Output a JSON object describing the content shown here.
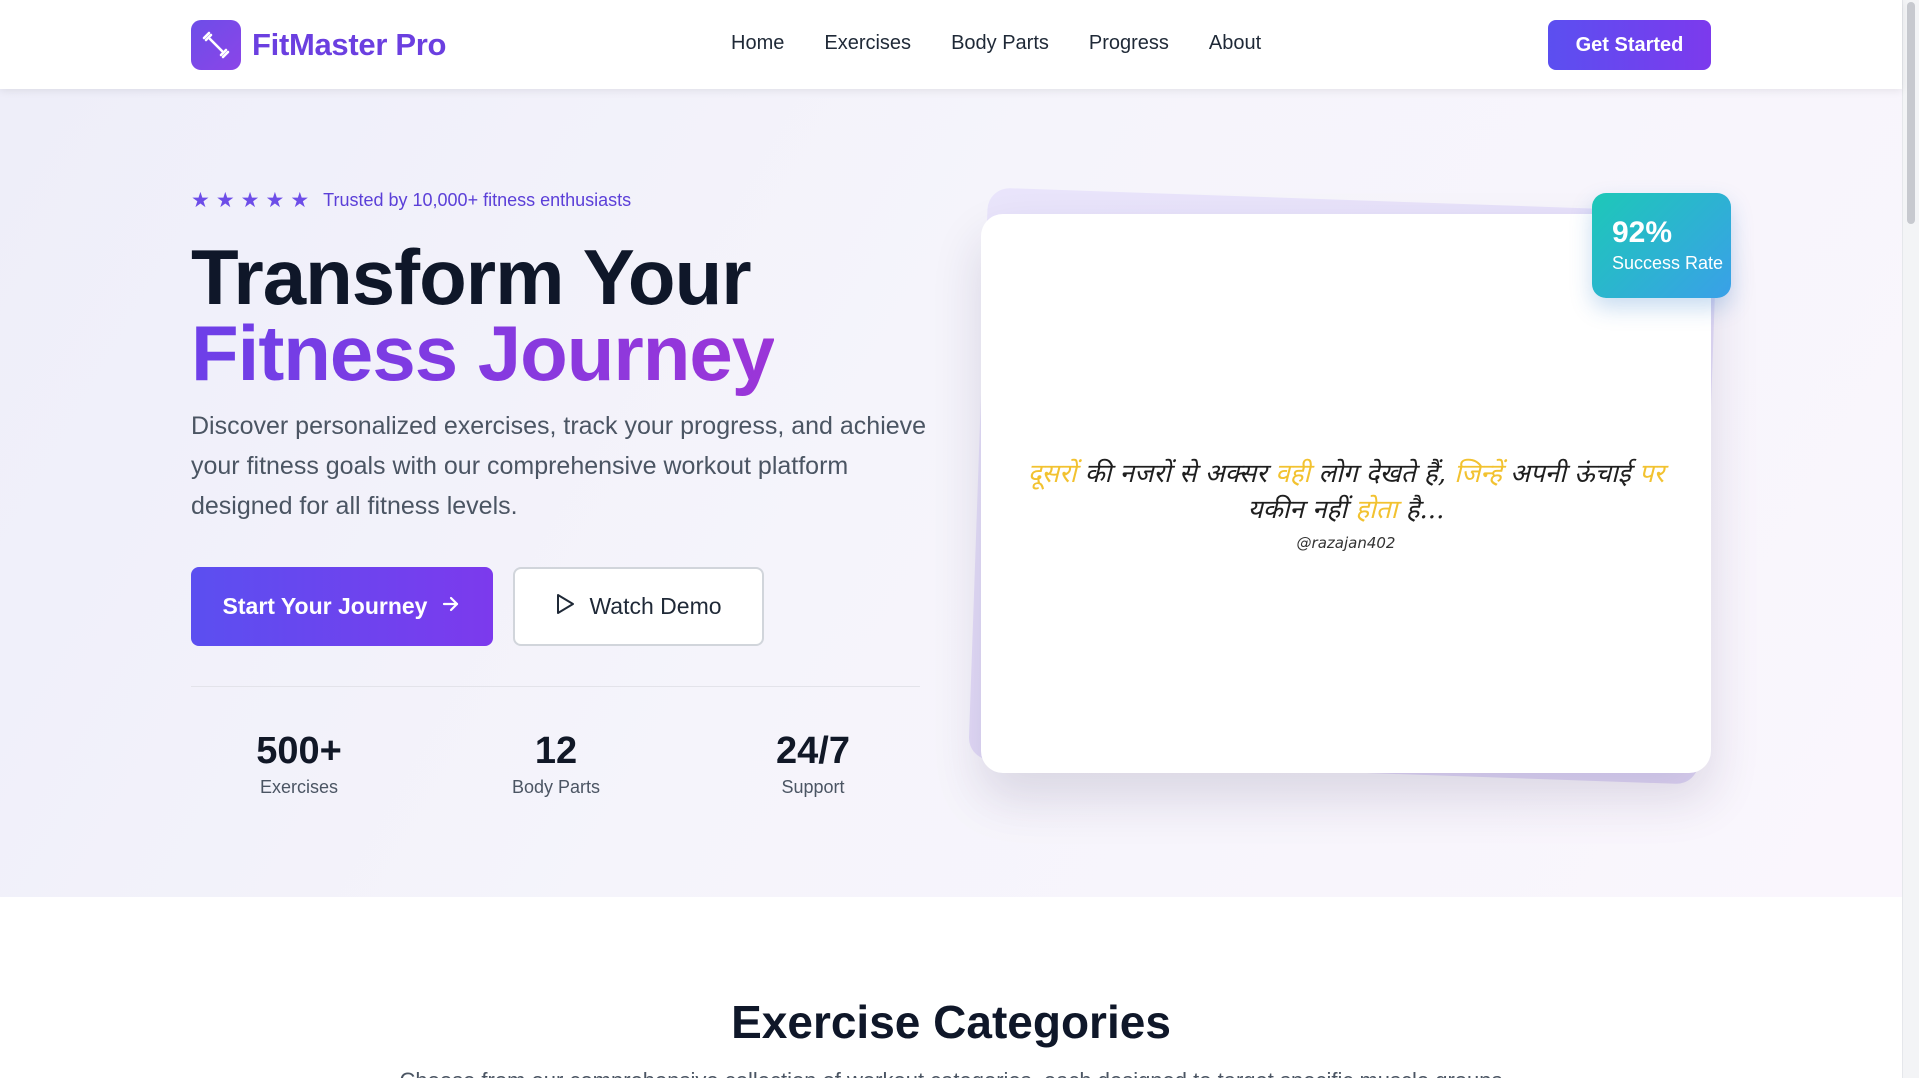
{
  "nav": {
    "brand": "FitMaster Pro",
    "links": [
      "Home",
      "Exercises",
      "Body Parts",
      "Progress",
      "About"
    ],
    "cta": "Get Started"
  },
  "hero": {
    "rating_stars": 5,
    "trust_text": "Trusted by 10,000+ fitness enthusiasts",
    "title_line1": "Transform Your",
    "title_line2": "Fitness Journey",
    "description": "Discover personalized exercises, track your progress, and achieve your fitness goals with our comprehensive workout platform designed for all fitness levels.",
    "primary_button": "Start Your Journey",
    "secondary_button": "Watch Demo",
    "stats": [
      {
        "value": "500+",
        "label": "Exercises"
      },
      {
        "value": "12",
        "label": "Body Parts"
      },
      {
        "value": "24/7",
        "label": "Support"
      }
    ]
  },
  "card": {
    "quote_parts": [
      "दूसरों",
      " की नजरों से अक्सर ",
      "वही",
      " लोग देखते हैं, ",
      "जिन्हें",
      " अपनी ऊंचाई ",
      "पर",
      " यकीन नहीं ",
      "होता",
      " है..."
    ],
    "handle": "@razajan402",
    "badge_value": "92%",
    "badge_label": "Success Rate"
  },
  "section": {
    "title": "Exercise Categories",
    "subtitle": "Choose from our comprehensive collection of workout categories, each designed to target specific muscle groups"
  },
  "colors": {
    "brand": "#6b3fe0",
    "accent_gradient_start": "#5b4ff0",
    "accent_gradient_end": "#7c3aed",
    "badge_gradient_start": "#1dc8b8",
    "badge_gradient_end": "#3aa0e8",
    "quote_highlight": "#f2c230"
  },
  "icons": [
    "dumbbell-icon",
    "star-icon",
    "arrow-right-icon",
    "play-icon"
  ]
}
